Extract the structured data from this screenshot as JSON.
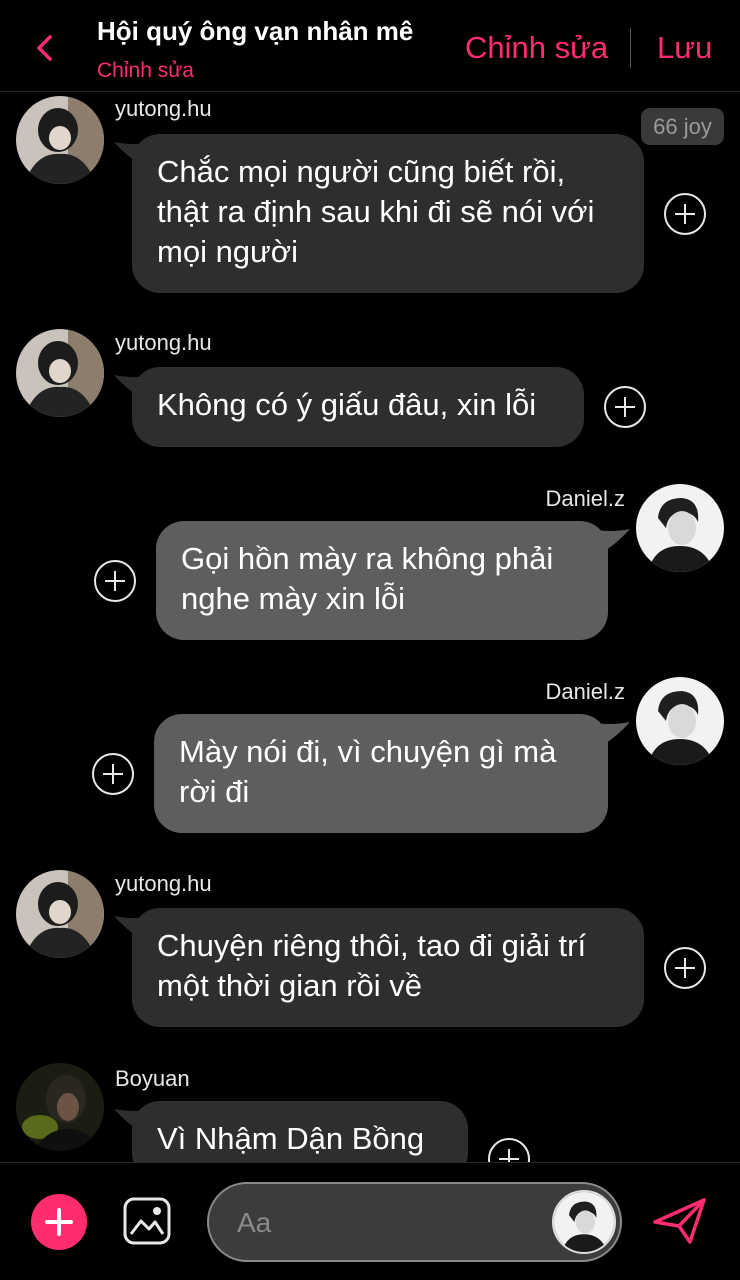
{
  "header": {
    "title": "Hội quý ông vạn nhân mê",
    "subtitle": "Chỉnh sửa",
    "edit_label": "Chỉnh sửa",
    "save_label": "Lưu",
    "accent_color": "#ff2d6f"
  },
  "badge": {
    "label": "66 joy"
  },
  "messages": [
    {
      "sender": "yutong.hu",
      "side": "left",
      "text_lines": [
        "Chắc mọi người cũng biết rồi,",
        "thật ra định sau khi đi sẽ nói với",
        "mọi người"
      ]
    },
    {
      "sender": "yutong.hu",
      "side": "left",
      "text_lines": [
        "Không có ý giấu đâu, xin lỗi"
      ]
    },
    {
      "sender": "Daniel.z",
      "side": "right",
      "text_lines": [
        "Gọi hồn mày ra không phải",
        "nghe mày xin lỗi"
      ]
    },
    {
      "sender": "Daniel.z",
      "side": "right",
      "text_lines": [
        "Mày nói đi, vì chuyện gì mà",
        "rời đi"
      ]
    },
    {
      "sender": "yutong.hu",
      "side": "left",
      "text_lines": [
        "Chuyện riêng thôi, tao đi giải trí",
        "một thời gian rồi về"
      ]
    },
    {
      "sender": "Boyuan",
      "side": "left",
      "text_lines": [
        "Vì Nhậm Dận Bồng"
      ]
    }
  ],
  "composer": {
    "placeholder": "Aa",
    "icons": [
      "plus-icon",
      "image-icon",
      "avatar",
      "send-icon"
    ]
  },
  "colors": {
    "background": "#000000",
    "bubble_left": "#2e2e2e",
    "bubble_right": "#5e5e5e"
  }
}
